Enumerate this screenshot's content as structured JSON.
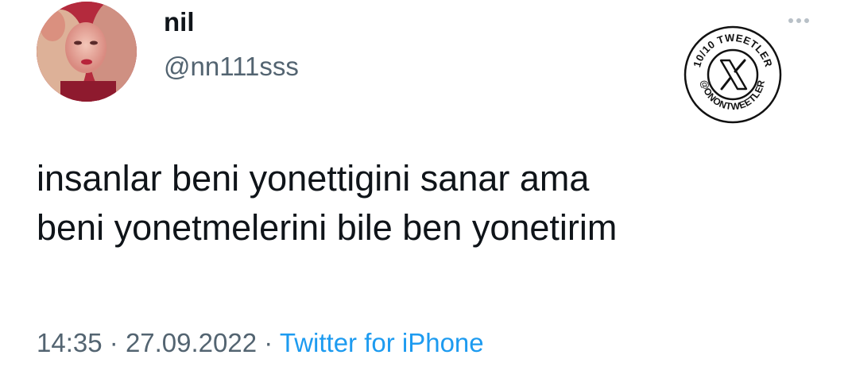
{
  "author": {
    "display_name": "nil",
    "handle": "@nn111sss",
    "avatar_icon": "profile-photo"
  },
  "menu": {
    "icon": "more-dots-icon"
  },
  "watermark": {
    "top_text": "10/10 TWEETLER",
    "bottom_text": "@ONONTWEETLER",
    "logo": "X"
  },
  "tweet": {
    "lines": [
      "insanlar beni yonettigini sanar ama",
      "beni yonetmelerini bile ben yonetirim"
    ]
  },
  "meta": {
    "time": "14:35",
    "separator": "·",
    "date": "27.09.2022",
    "source": "Twitter for iPhone"
  },
  "colors": {
    "text": "#0f1419",
    "secondary": "#536471",
    "link": "#1d9bf0"
  }
}
